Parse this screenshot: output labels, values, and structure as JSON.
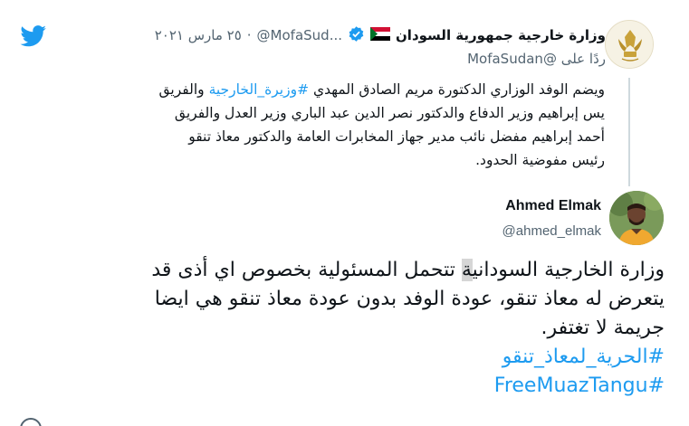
{
  "parent_tweet": {
    "author_name": "وزارة خارجية جمهورية السودان",
    "flag": "🇸🇩",
    "handle": "@MofaSud...",
    "separator": "·",
    "timestamp": "٢٥ مارس ٢٠٢١",
    "reply_to_prefix": "ردًا على",
    "reply_to_handle": "@MofaSudan",
    "body_lines": [
      {
        "text": "ويضم الوفد الوزاري الدكتورة مريم الصادق المهدي ",
        "hashtag": "#وزيرة_الخارجية",
        "suffix": " والفريق"
      },
      {
        "text": "يس إبراهيم وزير الدفاع والدكتور نصر الدين عبد الباري وزير العدل والفريق"
      },
      {
        "text": "أحمد إبراهيم مفضل نائب مدير جهاز المخابرات العامة والدكتور معاذ تنقو"
      },
      {
        "text": "رئيس مفوضية الحدود."
      }
    ]
  },
  "main_tweet": {
    "author_name": "Ahmed Elmak",
    "handle": "@ahmed_elmak",
    "body": {
      "line1_before": "وزارة الخارجية السوداني",
      "line1_selected": "ة",
      "line1_after": " تتحمل المسئولية بخصوص اي أذى قد",
      "line2": "يتعرض له معاذ تنقو، عودة الوفد بدون عودة معاذ تنقو هي ايضا",
      "line3": "جريمة لا تغتفر."
    },
    "hashtags": [
      "#الحرية_لمعاذ_تنقو",
      "#FreeMuazTangu"
    ]
  },
  "colors": {
    "link": "#1d9bf0",
    "secondary_text": "#536471",
    "verified": "#1d9bf0",
    "twitter_blue": "#1d9bf0"
  },
  "icons": [
    "twitter-bird-icon",
    "verified-badge-icon",
    "sudan-flag-icon"
  ]
}
